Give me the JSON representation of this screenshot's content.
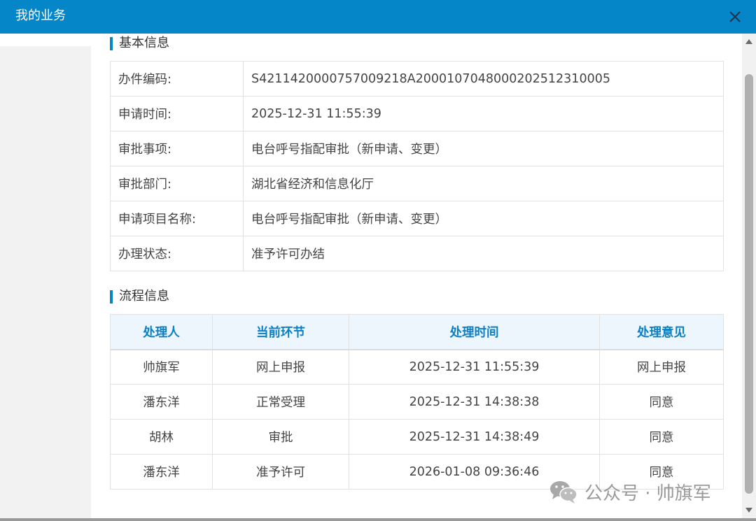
{
  "window": {
    "title": "我的业务"
  },
  "basic_info": {
    "heading": "基本信息",
    "rows": [
      {
        "label": "办件编码:",
        "value": "S4211420000757009218A2000107048000202512310005"
      },
      {
        "label": "申请时间:",
        "value": "2025-12-31 11:55:39"
      },
      {
        "label": "审批事项:",
        "value": "电台呼号指配审批（新申请、变更）"
      },
      {
        "label": "审批部门:",
        "value": "湖北省经济和信息化厅"
      },
      {
        "label": "申请项目名称:",
        "value": "电台呼号指配审批（新申请、变更）"
      },
      {
        "label": "办理状态:",
        "value": "准予许可办结"
      }
    ]
  },
  "process_info": {
    "heading": "流程信息",
    "columns": [
      "处理人",
      "当前环节",
      "处理时间",
      "处理意见"
    ],
    "rows": [
      [
        "帅旗军",
        "网上申报",
        "2025-12-31 11:55:39",
        "网上申报"
      ],
      [
        "潘东洋",
        "正常受理",
        "2025-12-31 14:38:38",
        "同意"
      ],
      [
        "胡林",
        "审批",
        "2025-12-31 14:38:49",
        "同意"
      ],
      [
        "潘东洋",
        "准予许可",
        "2026-01-08 09:36:46",
        "同意"
      ]
    ]
  },
  "watermark": {
    "text": "公众号 · 帅旗军",
    "icon": "wechat-icon"
  },
  "colors": {
    "accent": "#0586c9",
    "header_text": "#0a7fc4",
    "header_bg": "#eef6fd"
  }
}
